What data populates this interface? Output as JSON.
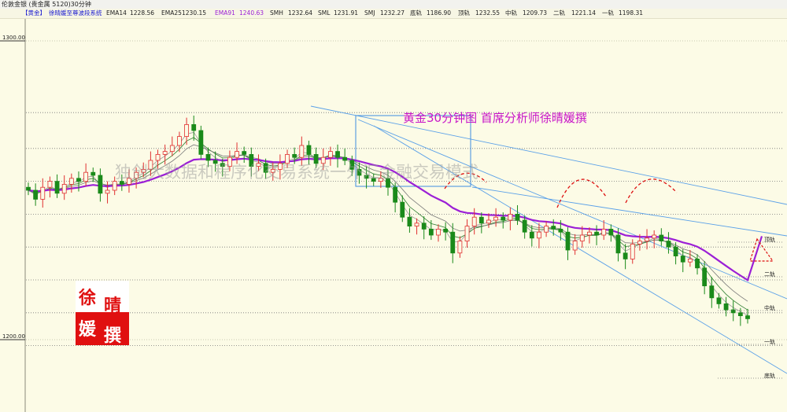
{
  "titlebar": {
    "title": "伦敦金银 (贵金属 5120)30分钟"
  },
  "infobar": {
    "symbol": "【黄金】",
    "system": "徐晴媛至尊波段系统",
    "items": [
      {
        "label": "EMA14",
        "value": "1228.56"
      },
      {
        "label": "EMA25",
        "value": "1230.15"
      },
      {
        "label": "EMA91",
        "value": "1240.63"
      },
      {
        "label": "SMH",
        "value": "1232.64"
      },
      {
        "label": "SML",
        "value": "1231.91"
      },
      {
        "label": "SMJ",
        "value": "1232.27"
      },
      {
        "label": "底轨",
        "value": "1186.90"
      },
      {
        "label": "顶轨",
        "value": "1232.55"
      },
      {
        "label": "中轨",
        "value": "1209.73"
      },
      {
        "label": "二轨",
        "value": "1221.14"
      },
      {
        "label": "一轨",
        "value": "1198.31"
      }
    ],
    "colors": {
      "EMA91": "#9b1fd6"
    }
  },
  "annotation": {
    "title": "黄金30分钟图 首席分析师徐晴媛撰",
    "color": "#c815c8"
  },
  "watermark": "独创大数据和程序化交易系统一外汇金融交易模式",
  "logo": {
    "chars": [
      "徐",
      "晴",
      "媛",
      "撰"
    ],
    "colors": [
      "#e01010",
      "#ffffff"
    ]
  },
  "chart_data": {
    "type": "candlestick",
    "instrument": "黄金",
    "timeframe": "30分钟",
    "ytick_labels": [
      "1300.00",
      "1200.00"
    ],
    "ylim": [
      1193,
      1322
    ],
    "close_series": [
      1250,
      1247,
      1251,
      1253,
      1249,
      1252,
      1254,
      1253,
      1256,
      1255,
      1249,
      1250,
      1253,
      1252,
      1254,
      1256,
      1257,
      1260,
      1262,
      1263,
      1265,
      1268,
      1272,
      1270,
      1262,
      1260,
      1259,
      1258,
      1261,
      1263,
      1262,
      1258,
      1259,
      1256,
      1257,
      1259,
      1262,
      1261,
      1265,
      1262,
      1259,
      1261,
      1263,
      1261,
      1260,
      1257,
      1255,
      1254,
      1253,
      1254,
      1251,
      1246,
      1241,
      1238,
      1239,
      1237,
      1235,
      1237,
      1236,
      1229,
      1233,
      1238,
      1241,
      1239,
      1240,
      1241,
      1240,
      1242,
      1240,
      1236,
      1234,
      1236,
      1238,
      1237,
      1236,
      1230,
      1233,
      1235,
      1236,
      1235,
      1237,
      1235,
      1229,
      1227,
      1232,
      1233,
      1234,
      1235,
      1233,
      1231,
      1228,
      1226,
      1227,
      1224,
      1218,
      1214,
      1212,
      1210,
      1209,
      1208,
      1207
    ],
    "support_resistance_levels": [
      1276,
      1264,
      1253,
      1242,
      1231,
      1220,
      1209,
      1198,
      1187
    ],
    "level_labels": [
      {
        "text": "顶轨",
        "value": 1232.55
      },
      {
        "text": "二轨",
        "value": 1221.14
      },
      {
        "text": "中轨",
        "value": 1209.73
      },
      {
        "text": "一轨",
        "value": 1198.31
      },
      {
        "text": "底轨",
        "value": 1186.9
      }
    ],
    "moving_averages": [
      {
        "name": "EMA91",
        "color": "#9b1fd6",
        "last": 1240.63
      },
      {
        "name": "EMA25",
        "color": "#7a7a7a",
        "last": 1230.15
      },
      {
        "name": "EMA14",
        "color": "#2e7d32",
        "last": 1228.56
      }
    ],
    "colors": {
      "up": "#e03030",
      "down": "#1a8a1a",
      "channel": "#5aa0e8",
      "box": "#3e8ee0",
      "arc": "#dd1111"
    }
  }
}
